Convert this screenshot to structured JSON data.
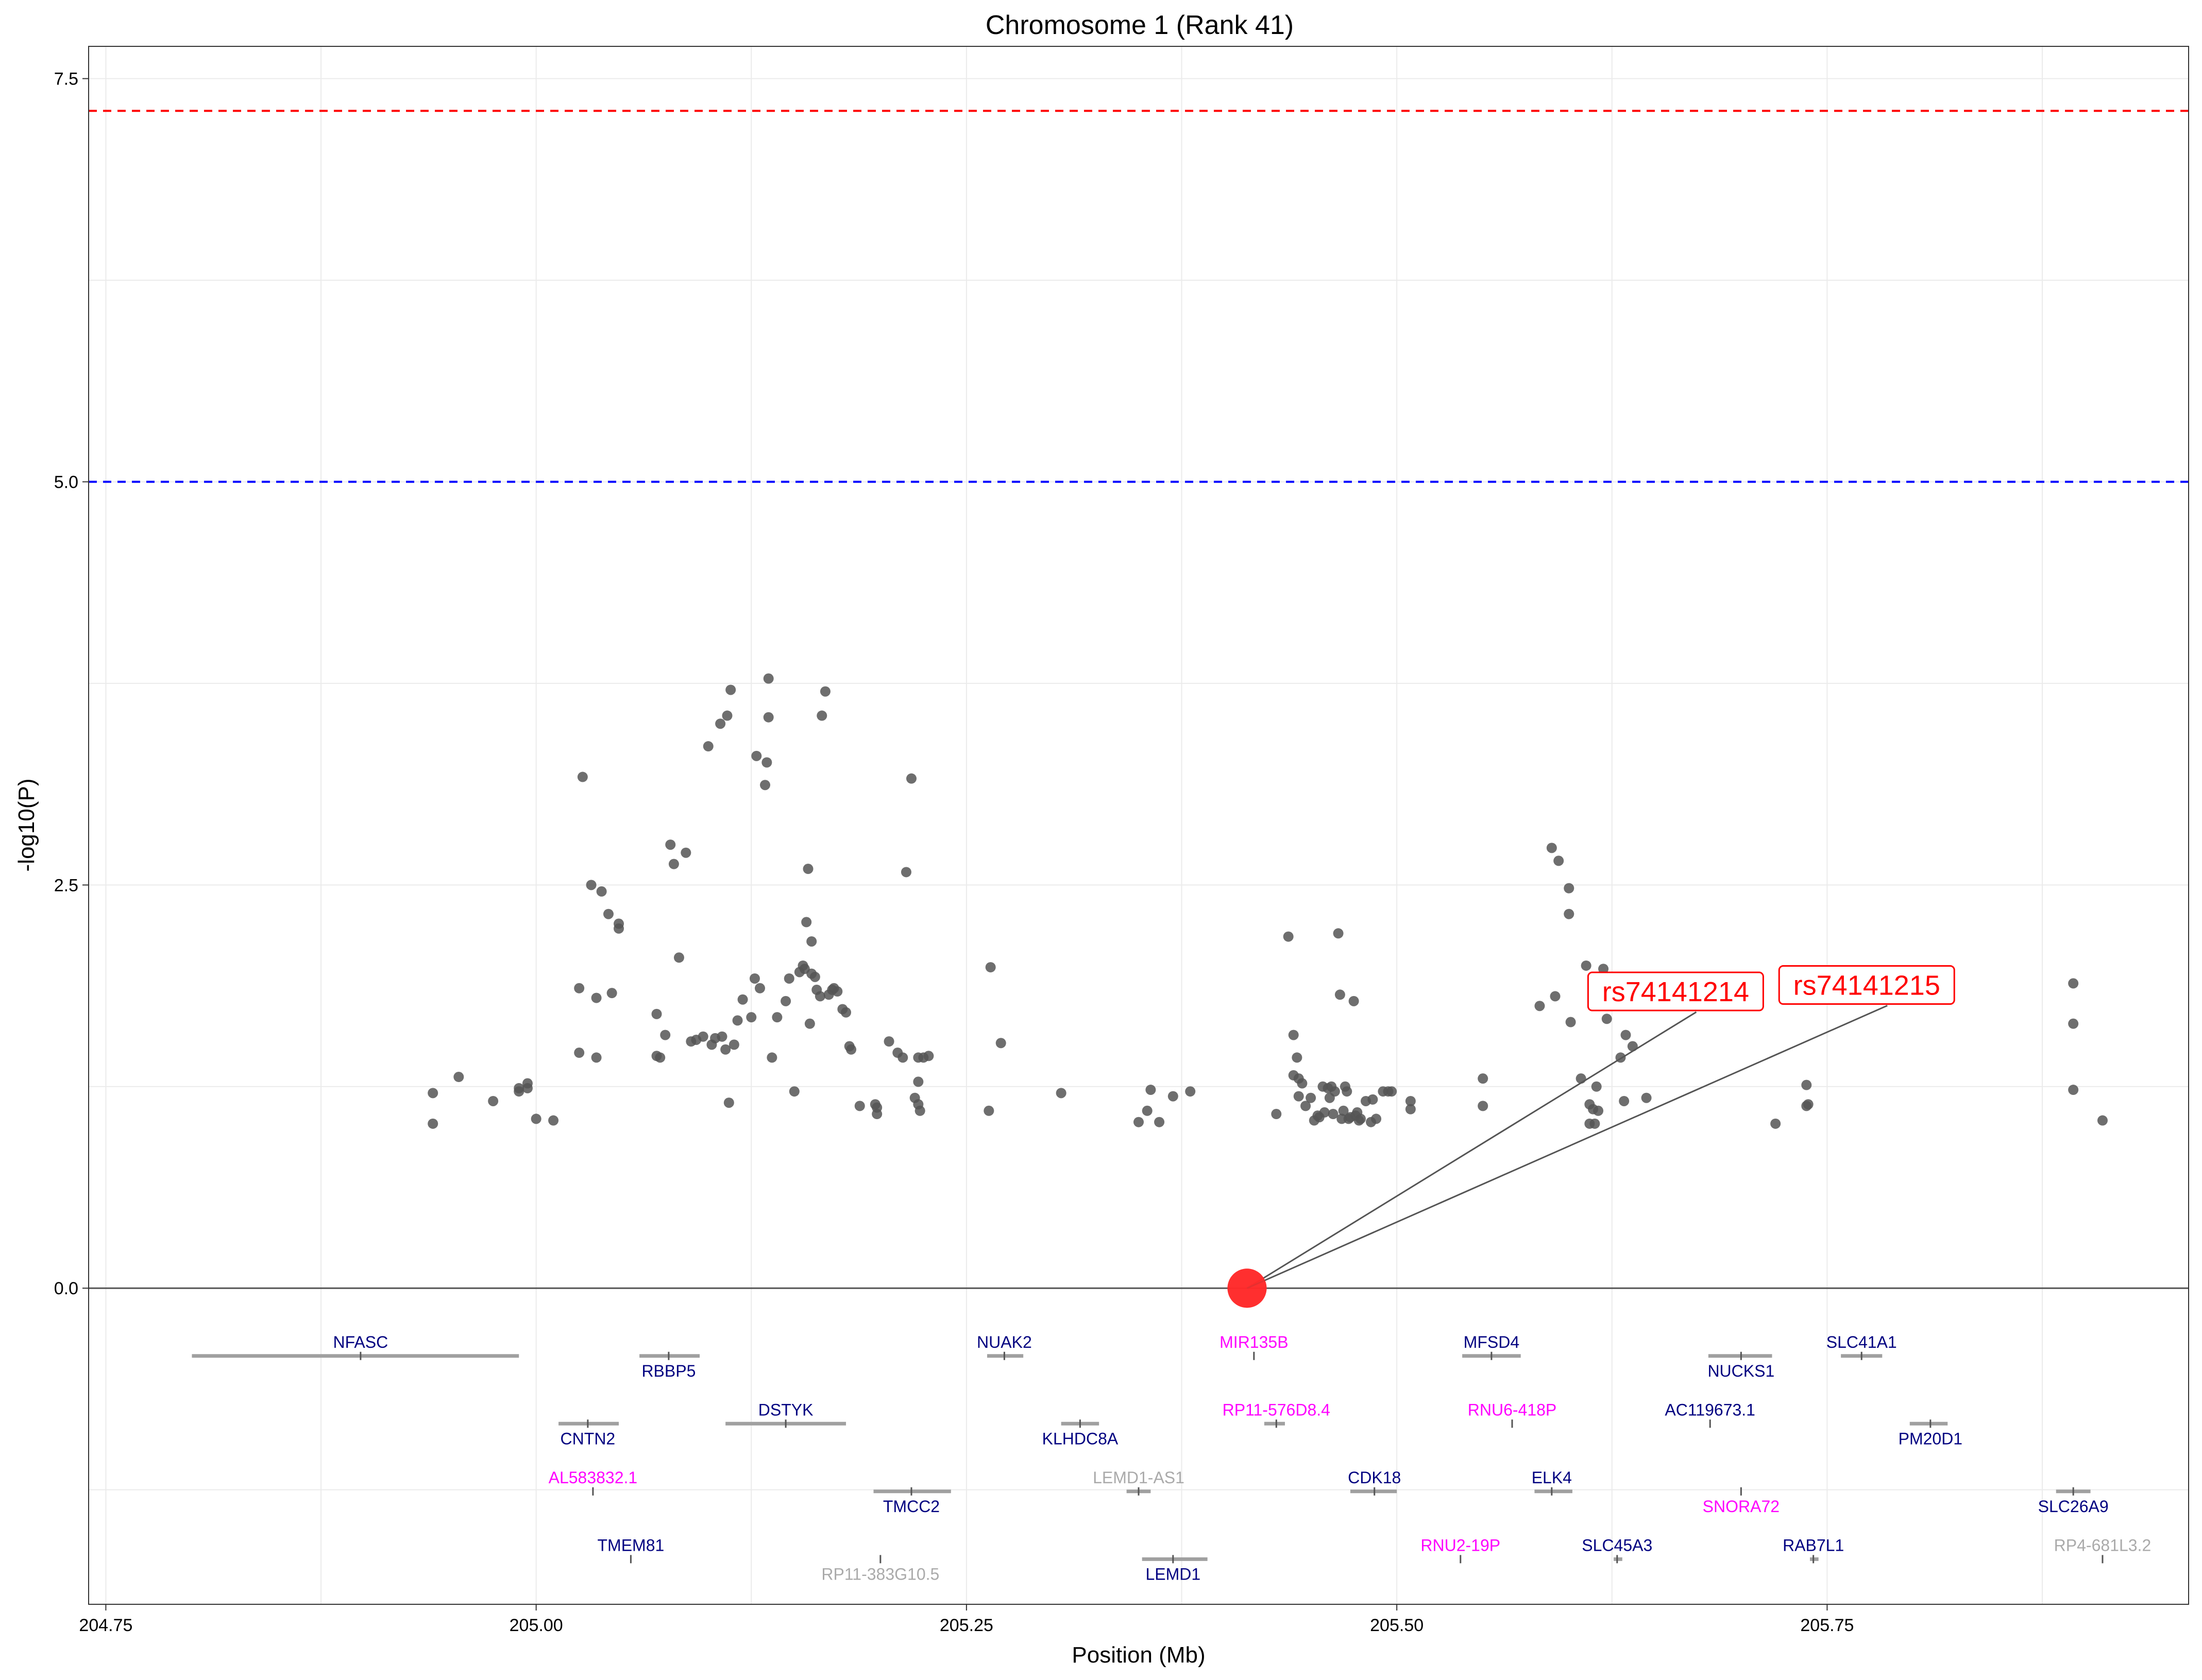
{
  "chart_data": {
    "type": "scatter",
    "title": "Chromosome 1 (Rank 41)",
    "xlabel": "Position (Mb)",
    "ylabel": "-log10(P)",
    "xlim": [
      204.74,
      205.96
    ],
    "ylim": [
      -1.96,
      7.7
    ],
    "x_ticks": [
      {
        "value": 204.75,
        "label": "204.75"
      },
      {
        "value": 205.0,
        "label": "205.00"
      },
      {
        "value": 205.25,
        "label": "205.25"
      },
      {
        "value": 205.5,
        "label": "205.50"
      },
      {
        "value": 205.75,
        "label": "205.75"
      }
    ],
    "y_ticks": [
      {
        "value": 0.0,
        "label": "0.0"
      },
      {
        "value": 2.5,
        "label": "2.5"
      },
      {
        "value": 5.0,
        "label": "5.0"
      },
      {
        "value": 7.5,
        "label": "7.5"
      }
    ],
    "grid": true,
    "thresholds": [
      {
        "value": 7.3,
        "color": "#ff0000",
        "style": "dashed"
      },
      {
        "value": 5.0,
        "color": "#0000ff",
        "style": "dashed"
      },
      {
        "value": 0.0,
        "color": "#555555",
        "style": "solid"
      }
    ],
    "colors": {
      "points": "#555555",
      "highlight": "#ff2a2a",
      "gene_bar": "#a0a0a0",
      "protein_coding": "#000080",
      "noncoding": "#ff00ff",
      "other": "#aaaaaa"
    },
    "points": [
      [
        204.94,
        1.21
      ],
      [
        204.94,
        1.02
      ],
      [
        204.955,
        1.31
      ],
      [
        204.975,
        1.16
      ],
      [
        204.99,
        1.22
      ],
      [
        204.99,
        1.24
      ],
      [
        204.995,
        1.27
      ],
      [
        204.995,
        1.24
      ],
      [
        205.0,
        1.05
      ],
      [
        205.01,
        1.04
      ],
      [
        205.025,
        1.86
      ],
      [
        205.025,
        1.46
      ],
      [
        205.027,
        3.17
      ],
      [
        205.032,
        2.5
      ],
      [
        205.035,
        1.8
      ],
      [
        205.035,
        1.43
      ],
      [
        205.038,
        2.46
      ],
      [
        205.042,
        2.32
      ],
      [
        205.044,
        1.83
      ],
      [
        205.048,
        2.26
      ],
      [
        205.048,
        2.23
      ],
      [
        205.07,
        1.7
      ],
      [
        205.07,
        1.44
      ],
      [
        205.072,
        1.43
      ],
      [
        205.075,
        1.57
      ],
      [
        205.078,
        2.75
      ],
      [
        205.08,
        2.63
      ],
      [
        205.083,
        2.05
      ],
      [
        205.087,
        2.7
      ],
      [
        205.09,
        1.53
      ],
      [
        205.093,
        1.54
      ],
      [
        205.097,
        1.56
      ],
      [
        205.1,
        3.36
      ],
      [
        205.102,
        1.51
      ],
      [
        205.104,
        1.55
      ],
      [
        205.107,
        3.5
      ],
      [
        205.108,
        1.56
      ],
      [
        205.11,
        1.48
      ],
      [
        205.111,
        3.55
      ],
      [
        205.112,
        1.15
      ],
      [
        205.113,
        3.71
      ],
      [
        205.115,
        1.51
      ],
      [
        205.117,
        1.66
      ],
      [
        205.12,
        1.79
      ],
      [
        205.125,
        1.68
      ],
      [
        205.127,
        1.92
      ],
      [
        205.128,
        3.3
      ],
      [
        205.13,
        1.86
      ],
      [
        205.133,
        3.12
      ],
      [
        205.134,
        3.26
      ],
      [
        205.135,
        3.54
      ],
      [
        205.135,
        3.78
      ],
      [
        205.137,
        1.43
      ],
      [
        205.14,
        1.68
      ],
      [
        205.145,
        1.78
      ],
      [
        205.147,
        1.92
      ],
      [
        205.15,
        1.22
      ],
      [
        205.153,
        1.96
      ],
      [
        205.155,
        2.0
      ],
      [
        205.156,
        1.98
      ],
      [
        205.157,
        2.27
      ],
      [
        205.158,
        2.6
      ],
      [
        205.159,
        1.64
      ],
      [
        205.16,
        2.15
      ],
      [
        205.16,
        1.95
      ],
      [
        205.162,
        1.93
      ],
      [
        205.163,
        1.85
      ],
      [
        205.165,
        1.81
      ],
      [
        205.166,
        3.55
      ],
      [
        205.168,
        3.7
      ],
      [
        205.17,
        1.82
      ],
      [
        205.172,
        1.85
      ],
      [
        205.173,
        1.86
      ],
      [
        205.175,
        1.84
      ],
      [
        205.178,
        1.73
      ],
      [
        205.18,
        1.71
      ],
      [
        205.182,
        1.5
      ],
      [
        205.183,
        1.48
      ],
      [
        205.188,
        1.13
      ],
      [
        205.197,
        1.14
      ],
      [
        205.198,
        1.12
      ],
      [
        205.198,
        1.08
      ],
      [
        205.205,
        1.53
      ],
      [
        205.21,
        1.46
      ],
      [
        205.213,
        1.43
      ],
      [
        205.215,
        2.58
      ],
      [
        205.218,
        3.16
      ],
      [
        205.22,
        1.18
      ],
      [
        205.222,
        1.28
      ],
      [
        205.222,
        1.14
      ],
      [
        205.223,
        1.1
      ],
      [
        205.222,
        1.43
      ],
      [
        205.225,
        1.43
      ],
      [
        205.228,
        1.44
      ],
      [
        205.263,
        1.1
      ],
      [
        205.264,
        1.99
      ],
      [
        205.27,
        1.52
      ],
      [
        205.305,
        1.21
      ],
      [
        205.35,
        1.03
      ],
      [
        205.355,
        1.1
      ],
      [
        205.357,
        1.23
      ],
      [
        205.362,
        1.03
      ],
      [
        205.37,
        1.19
      ],
      [
        205.38,
        1.22
      ],
      [
        205.43,
        1.08
      ],
      [
        205.437,
        2.18
      ],
      [
        205.44,
        1.57
      ],
      [
        205.44,
        1.32
      ],
      [
        205.442,
        1.43
      ],
      [
        205.443,
        1.3
      ],
      [
        205.443,
        1.19
      ],
      [
        205.445,
        1.27
      ],
      [
        205.447,
        1.13
      ],
      [
        205.45,
        1.18
      ],
      [
        205.452,
        1.04
      ],
      [
        205.454,
        1.07
      ],
      [
        205.455,
        1.06
      ],
      [
        205.457,
        1.25
      ],
      [
        205.458,
        1.09
      ],
      [
        205.46,
        1.24
      ],
      [
        205.461,
        1.18
      ],
      [
        205.462,
        1.25
      ],
      [
        205.463,
        1.08
      ],
      [
        205.464,
        1.22
      ],
      [
        205.466,
        2.2
      ],
      [
        205.467,
        1.82
      ],
      [
        205.468,
        1.05
      ],
      [
        205.469,
        1.1
      ],
      [
        205.47,
        1.25
      ],
      [
        205.471,
        1.22
      ],
      [
        205.472,
        1.05
      ],
      [
        205.473,
        1.06
      ],
      [
        205.475,
        1.78
      ],
      [
        205.476,
        1.07
      ],
      [
        205.477,
        1.09
      ],
      [
        205.478,
        1.04
      ],
      [
        205.479,
        1.05
      ],
      [
        205.482,
        1.16
      ],
      [
        205.485,
        1.03
      ],
      [
        205.486,
        1.17
      ],
      [
        205.488,
        1.05
      ],
      [
        205.492,
        1.22
      ],
      [
        205.495,
        1.22
      ],
      [
        205.497,
        1.22
      ],
      [
        205.508,
        1.11
      ],
      [
        205.508,
        1.16
      ],
      [
        205.55,
        1.3
      ],
      [
        205.55,
        1.13
      ],
      [
        205.583,
        1.75
      ],
      [
        205.59,
        2.73
      ],
      [
        205.592,
        1.81
      ],
      [
        205.594,
        2.65
      ],
      [
        205.6,
        2.48
      ],
      [
        205.6,
        2.32
      ],
      [
        205.601,
        1.65
      ],
      [
        205.607,
        1.3
      ],
      [
        205.61,
        2.0
      ],
      [
        205.612,
        1.02
      ],
      [
        205.612,
        1.14
      ],
      [
        205.614,
        1.11
      ],
      [
        205.615,
        1.02
      ],
      [
        205.616,
        1.25
      ],
      [
        205.617,
        1.1
      ],
      [
        205.62,
        1.98
      ],
      [
        205.622,
        1.67
      ],
      [
        205.63,
        1.43
      ],
      [
        205.632,
        1.16
      ],
      [
        205.633,
        1.57
      ],
      [
        205.637,
        1.5
      ],
      [
        205.645,
        1.18
      ],
      [
        205.72,
        1.02
      ],
      [
        205.738,
        1.26
      ],
      [
        205.738,
        1.13
      ],
      [
        205.739,
        1.14
      ],
      [
        205.893,
        1.89
      ],
      [
        205.893,
        1.64
      ],
      [
        205.893,
        1.23
      ],
      [
        205.91,
        1.04
      ]
    ],
    "highlight": [
      {
        "snp": "rs74141214",
        "x": 205.413,
        "y": 0.0,
        "label_x": 205.662,
        "label_y": 1.84
      },
      {
        "snp": "rs74141215",
        "x": 205.413,
        "y": 0.0,
        "label_x": 205.773,
        "label_y": 1.88
      }
    ],
    "genes": [
      {
        "name": "NFASC",
        "start": 204.8,
        "end": 204.99,
        "mid": 204.898,
        "y": -0.42,
        "label_pos": "above",
        "class": "protein_coding"
      },
      {
        "name": "RBBP5",
        "start": 205.06,
        "end": 205.095,
        "mid": 205.077,
        "y": -0.42,
        "label_pos": "below",
        "class": "protein_coding"
      },
      {
        "name": "NUAK2",
        "start": 205.262,
        "end": 205.283,
        "mid": 205.272,
        "y": -0.42,
        "label_pos": "above",
        "class": "protein_coding"
      },
      {
        "name": "MIR135B",
        "start": 205.417,
        "end": 205.417,
        "mid": 205.417,
        "y": -0.42,
        "label_pos": "above",
        "class": "noncoding"
      },
      {
        "name": "MFSD4",
        "start": 205.538,
        "end": 205.572,
        "mid": 205.555,
        "y": -0.42,
        "label_pos": "above",
        "class": "protein_coding"
      },
      {
        "name": "NUCKS1",
        "start": 205.681,
        "end": 205.718,
        "mid": 205.7,
        "y": -0.42,
        "label_pos": "below",
        "class": "protein_coding"
      },
      {
        "name": "SLC41A1",
        "start": 205.758,
        "end": 205.782,
        "mid": 205.77,
        "y": -0.42,
        "label_pos": "above",
        "class": "protein_coding"
      },
      {
        "name": "CNTN2",
        "start": 205.013,
        "end": 205.048,
        "mid": 205.03,
        "y": -0.84,
        "label_pos": "below",
        "class": "protein_coding"
      },
      {
        "name": "DSTYK",
        "start": 205.11,
        "end": 205.18,
        "mid": 205.145,
        "y": -0.84,
        "label_pos": "above",
        "class": "protein_coding"
      },
      {
        "name": "KLHDC8A",
        "start": 205.305,
        "end": 205.327,
        "mid": 205.316,
        "y": -0.84,
        "label_pos": "below",
        "class": "protein_coding"
      },
      {
        "name": "RP11-576D8.4",
        "start": 205.423,
        "end": 205.435,
        "mid": 205.43,
        "y": -0.84,
        "label_pos": "above",
        "class": "noncoding"
      },
      {
        "name": "RNU6-418P",
        "start": 205.567,
        "end": 205.567,
        "mid": 205.567,
        "y": -0.84,
        "label_pos": "above",
        "class": "noncoding"
      },
      {
        "name": "AC119673.1",
        "start": 205.682,
        "end": 205.682,
        "mid": 205.682,
        "y": -0.84,
        "label_pos": "above",
        "class": "protein_coding"
      },
      {
        "name": "PM20D1",
        "start": 205.798,
        "end": 205.82,
        "mid": 205.81,
        "y": -0.84,
        "label_pos": "below",
        "class": "protein_coding"
      },
      {
        "name": "AL583832.1",
        "start": 205.033,
        "end": 205.033,
        "mid": 205.033,
        "y": -1.26,
        "label_pos": "above",
        "class": "noncoding"
      },
      {
        "name": "TMCC2",
        "start": 205.196,
        "end": 205.241,
        "mid": 205.218,
        "y": -1.26,
        "label_pos": "below",
        "class": "protein_coding"
      },
      {
        "name": "LEMD1-AS1",
        "start": 205.343,
        "end": 205.357,
        "mid": 205.35,
        "y": -1.26,
        "label_pos": "above",
        "class": "other"
      },
      {
        "name": "CDK18",
        "start": 205.473,
        "end": 205.5,
        "mid": 205.487,
        "y": -1.26,
        "label_pos": "above",
        "class": "protein_coding"
      },
      {
        "name": "ELK4",
        "start": 205.58,
        "end": 205.602,
        "mid": 205.59,
        "y": -1.26,
        "label_pos": "above",
        "class": "protein_coding"
      },
      {
        "name": "SNORA72",
        "start": 205.7,
        "end": 205.7,
        "mid": 205.7,
        "y": -1.26,
        "label_pos": "below",
        "class": "noncoding"
      },
      {
        "name": "SLC26A9",
        "start": 205.883,
        "end": 205.903,
        "mid": 205.893,
        "y": -1.26,
        "label_pos": "below",
        "class": "protein_coding"
      },
      {
        "name": "TMEM81",
        "start": 205.055,
        "end": 205.055,
        "mid": 205.055,
        "y": -1.68,
        "label_pos": "above",
        "class": "protein_coding"
      },
      {
        "name": "RP11-383G10.5",
        "start": 205.2,
        "end": 205.2,
        "mid": 205.2,
        "y": -1.68,
        "label_pos": "below",
        "class": "other"
      },
      {
        "name": "LEMD1",
        "start": 205.352,
        "end": 205.39,
        "mid": 205.37,
        "y": -1.68,
        "label_pos": "below",
        "class": "protein_coding"
      },
      {
        "name": "RNU2-19P",
        "start": 205.537,
        "end": 205.537,
        "mid": 205.537,
        "y": -1.68,
        "label_pos": "above",
        "class": "noncoding"
      },
      {
        "name": "SLC45A3",
        "start": 205.626,
        "end": 205.631,
        "mid": 205.628,
        "y": -1.68,
        "label_pos": "above",
        "class": "protein_coding"
      },
      {
        "name": "RAB7L1",
        "start": 205.74,
        "end": 205.745,
        "mid": 205.742,
        "y": -1.68,
        "label_pos": "above",
        "class": "protein_coding"
      },
      {
        "name": "RP4-681L3.2",
        "start": 205.91,
        "end": 205.91,
        "mid": 205.91,
        "y": -1.68,
        "label_pos": "above",
        "class": "other"
      }
    ]
  }
}
